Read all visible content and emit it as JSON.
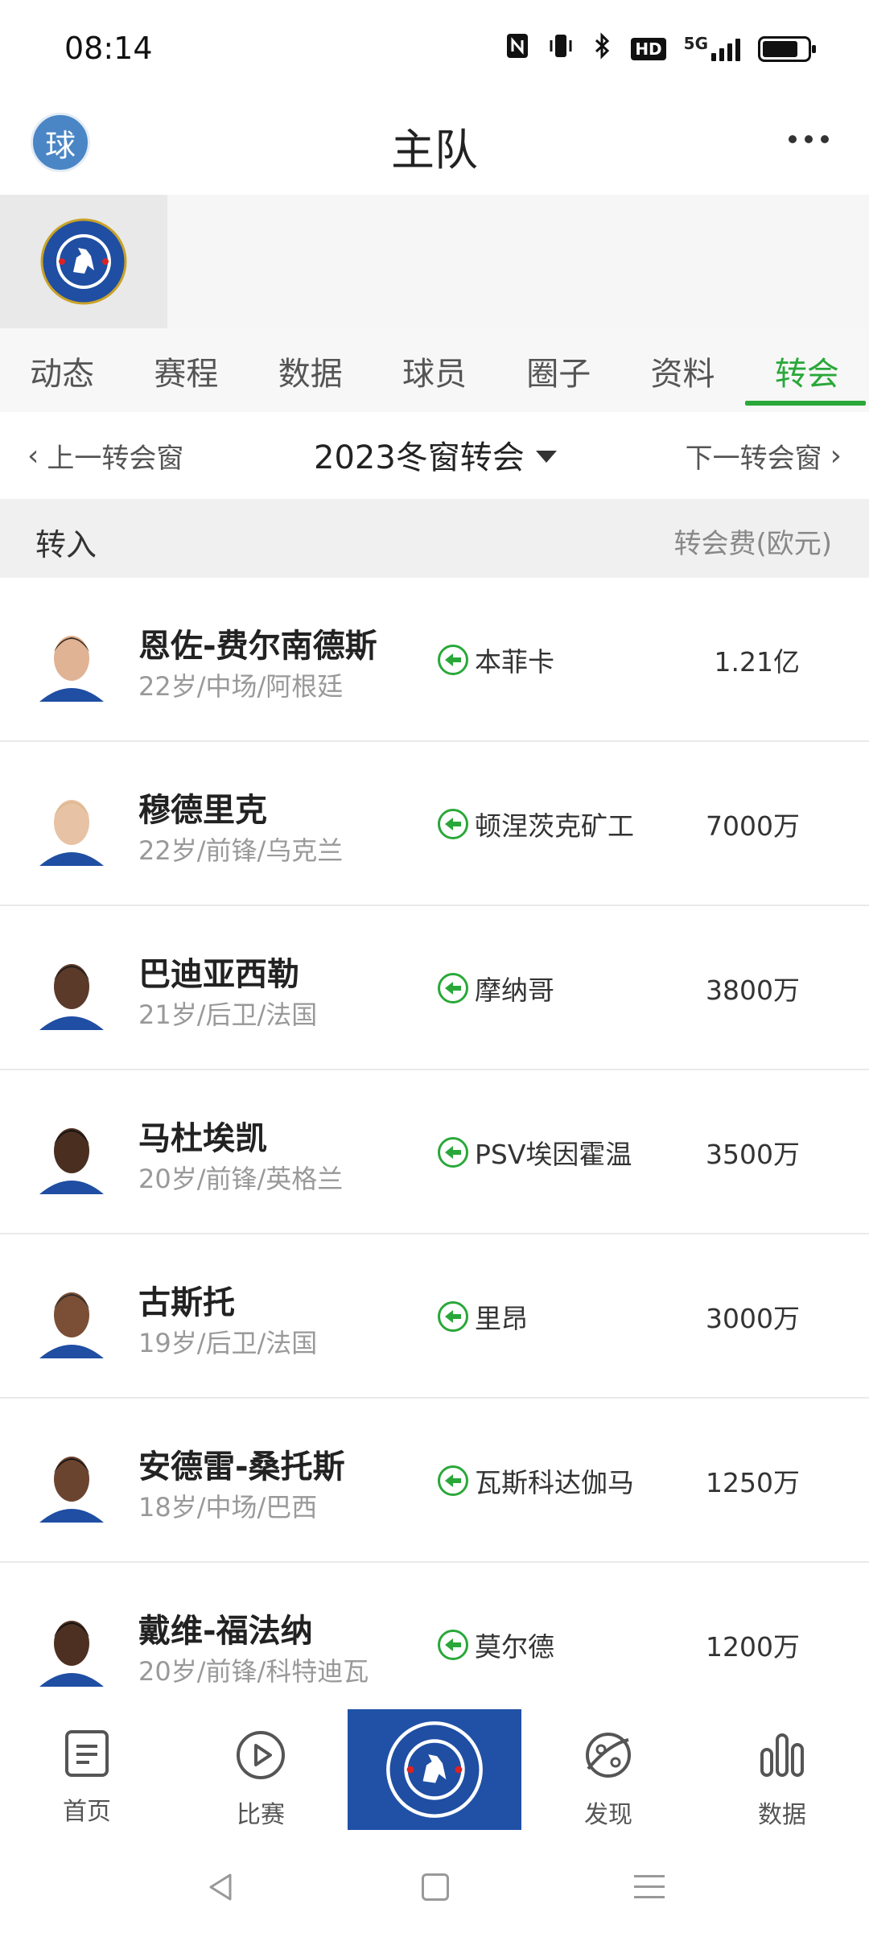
{
  "status_bar": {
    "time": "08:14",
    "icons": [
      "nfc-icon",
      "vibrate-icon",
      "bluetooth-icon",
      "hd-icon",
      "5g-signal-icon",
      "battery-icon"
    ],
    "hd_label": "HD",
    "network_label": "5G",
    "battery_level": 0.8
  },
  "header": {
    "app_badge": "球",
    "title": "主队"
  },
  "tabs": [
    {
      "label": "动态",
      "active": false
    },
    {
      "label": "赛程",
      "active": false
    },
    {
      "label": "数据",
      "active": false
    },
    {
      "label": "球员",
      "active": false
    },
    {
      "label": "圈子",
      "active": false
    },
    {
      "label": "资料",
      "active": false
    },
    {
      "label": "转会",
      "active": true
    }
  ],
  "window_bar": {
    "prev_label": "上一转会窗",
    "current": "2023冬窗转会",
    "next_label": "下一转会窗"
  },
  "section": {
    "title": "转入",
    "fee_header": "转会费(欧元)"
  },
  "transfers": [
    {
      "name": "恩佐-费尔南德斯",
      "info": "22岁/中场/阿根廷",
      "from": "本菲卡",
      "fee": "1.21亿"
    },
    {
      "name": "穆德里克",
      "info": "22岁/前锋/乌克兰",
      "from": "顿涅茨克矿工",
      "fee": "7000万"
    },
    {
      "name": "巴迪亚西勒",
      "info": "21岁/后卫/法国",
      "from": "摩纳哥",
      "fee": "3800万"
    },
    {
      "name": "马杜埃凯",
      "info": "20岁/前锋/英格兰",
      "from": "PSV埃因霍温",
      "fee": "3500万"
    },
    {
      "name": "古斯托",
      "info": "19岁/后卫/法国",
      "from": "里昂",
      "fee": "3000万"
    },
    {
      "name": "安德雷-桑托斯",
      "info": "18岁/中场/巴西",
      "from": "瓦斯科达伽马",
      "fee": "1250万"
    },
    {
      "name": "戴维-福法纳",
      "info": "20岁/前锋/科特迪瓦",
      "from": "莫尔德",
      "fee": "1200万"
    }
  ],
  "bottom_nav": {
    "home": "首页",
    "match": "比赛",
    "discover": "发现",
    "data": "数据"
  },
  "colors": {
    "accent": "#29a839",
    "club_blue": "#2151a7"
  }
}
